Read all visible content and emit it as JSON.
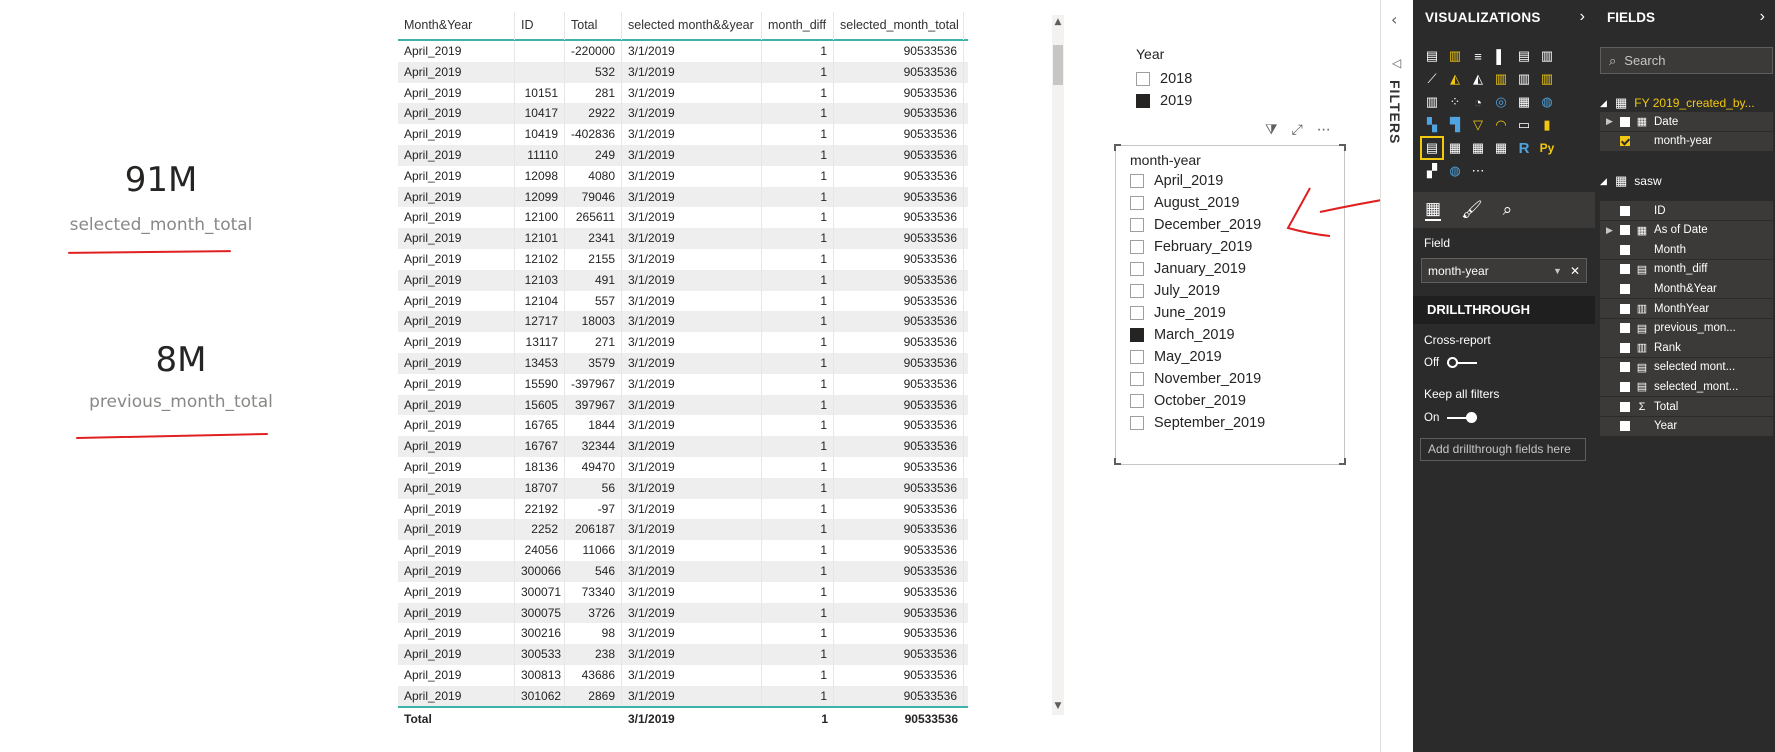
{
  "cards": [
    {
      "value": "91M",
      "label": "selected_month_total"
    },
    {
      "value": "8M",
      "label": "previous_month_total"
    }
  ],
  "table": {
    "columns": [
      "Month&Year",
      "ID",
      "Total",
      "selected month&&year",
      "month_diff",
      "selected_month_total"
    ],
    "rows": [
      [
        "April_2019",
        "",
        "-220000",
        "3/1/2019",
        "1",
        "90533536"
      ],
      [
        "April_2019",
        "",
        "532",
        "3/1/2019",
        "1",
        "90533536"
      ],
      [
        "April_2019",
        "10151",
        "281",
        "3/1/2019",
        "1",
        "90533536"
      ],
      [
        "April_2019",
        "10417",
        "2922",
        "3/1/2019",
        "1",
        "90533536"
      ],
      [
        "April_2019",
        "10419",
        "-402836",
        "3/1/2019",
        "1",
        "90533536"
      ],
      [
        "April_2019",
        "11110",
        "249",
        "3/1/2019",
        "1",
        "90533536"
      ],
      [
        "April_2019",
        "12098",
        "4080",
        "3/1/2019",
        "1",
        "90533536"
      ],
      [
        "April_2019",
        "12099",
        "79046",
        "3/1/2019",
        "1",
        "90533536"
      ],
      [
        "April_2019",
        "12100",
        "265611",
        "3/1/2019",
        "1",
        "90533536"
      ],
      [
        "April_2019",
        "12101",
        "2341",
        "3/1/2019",
        "1",
        "90533536"
      ],
      [
        "April_2019",
        "12102",
        "2155",
        "3/1/2019",
        "1",
        "90533536"
      ],
      [
        "April_2019",
        "12103",
        "491",
        "3/1/2019",
        "1",
        "90533536"
      ],
      [
        "April_2019",
        "12104",
        "557",
        "3/1/2019",
        "1",
        "90533536"
      ],
      [
        "April_2019",
        "12717",
        "18003",
        "3/1/2019",
        "1",
        "90533536"
      ],
      [
        "April_2019",
        "13117",
        "271",
        "3/1/2019",
        "1",
        "90533536"
      ],
      [
        "April_2019",
        "13453",
        "3579",
        "3/1/2019",
        "1",
        "90533536"
      ],
      [
        "April_2019",
        "15590",
        "-397967",
        "3/1/2019",
        "1",
        "90533536"
      ],
      [
        "April_2019",
        "15605",
        "397967",
        "3/1/2019",
        "1",
        "90533536"
      ],
      [
        "April_2019",
        "16765",
        "1844",
        "3/1/2019",
        "1",
        "90533536"
      ],
      [
        "April_2019",
        "16767",
        "32344",
        "3/1/2019",
        "1",
        "90533536"
      ],
      [
        "April_2019",
        "18136",
        "49470",
        "3/1/2019",
        "1",
        "90533536"
      ],
      [
        "April_2019",
        "18707",
        "56",
        "3/1/2019",
        "1",
        "90533536"
      ],
      [
        "April_2019",
        "22192",
        "-97",
        "3/1/2019",
        "1",
        "90533536"
      ],
      [
        "April_2019",
        "2252",
        "206187",
        "3/1/2019",
        "1",
        "90533536"
      ],
      [
        "April_2019",
        "24056",
        "11066",
        "3/1/2019",
        "1",
        "90533536"
      ],
      [
        "April_2019",
        "300066",
        "546",
        "3/1/2019",
        "1",
        "90533536"
      ],
      [
        "April_2019",
        "300071",
        "73340",
        "3/1/2019",
        "1",
        "90533536"
      ],
      [
        "April_2019",
        "300075",
        "3726",
        "3/1/2019",
        "1",
        "90533536"
      ],
      [
        "April_2019",
        "300216",
        "98",
        "3/1/2019",
        "1",
        "90533536"
      ],
      [
        "April_2019",
        "300533",
        "238",
        "3/1/2019",
        "1",
        "90533536"
      ],
      [
        "April_2019",
        "300813",
        "43686",
        "3/1/2019",
        "1",
        "90533536"
      ],
      [
        "April_2019",
        "301062",
        "2869",
        "3/1/2019",
        "1",
        "90533536"
      ]
    ],
    "total_row": [
      "Total",
      "",
      "",
      "3/1/2019",
      "1",
      "90533536"
    ]
  },
  "year_slicer": {
    "title": "Year",
    "items": [
      {
        "label": "2018",
        "checked": false
      },
      {
        "label": "2019",
        "checked": true
      }
    ]
  },
  "month_slicer": {
    "title": "month-year",
    "items": [
      {
        "label": "April_2019",
        "checked": false
      },
      {
        "label": "August_2019",
        "checked": false
      },
      {
        "label": "December_2019",
        "checked": false
      },
      {
        "label": "February_2019",
        "checked": false
      },
      {
        "label": "January_2019",
        "checked": false
      },
      {
        "label": "July_2019",
        "checked": false
      },
      {
        "label": "June_2019",
        "checked": false
      },
      {
        "label": "March_2019",
        "checked": true
      },
      {
        "label": "May_2019",
        "checked": false
      },
      {
        "label": "November_2019",
        "checked": false
      },
      {
        "label": "October_2019",
        "checked": false
      },
      {
        "label": "September_2019",
        "checked": false
      }
    ]
  },
  "filters_label": "FILTERS",
  "visualizations": {
    "title": "VISUALIZATIONS",
    "field_label": "Field",
    "field_value": "month-year",
    "drillthrough_title": "DRILLTHROUGH",
    "cross_report_label": "Cross-report",
    "cross_report_state": "Off",
    "keep_filters_label": "Keep all filters",
    "keep_filters_state": "On",
    "add_drill_placeholder": "Add drillthrough fields here",
    "r_label": "R",
    "py_label": "Py"
  },
  "fields": {
    "title": "FIELDS",
    "search_placeholder": "Search",
    "table1": "FY 2019_created_by...",
    "table1_fields": [
      {
        "name": "Date",
        "expandable": true,
        "checked": false,
        "type": "table"
      },
      {
        "name": "month-year",
        "expandable": false,
        "checked": true,
        "type": ""
      }
    ],
    "table2": "sasw",
    "table2_fields": [
      {
        "name": "ID",
        "expandable": false,
        "checked": false,
        "type": ""
      },
      {
        "name": "As of Date",
        "expandable": true,
        "checked": false,
        "type": "table"
      },
      {
        "name": "Month",
        "expandable": false,
        "checked": false,
        "type": ""
      },
      {
        "name": "month_diff",
        "expandable": false,
        "checked": false,
        "type": "calc"
      },
      {
        "name": "Month&Year",
        "expandable": false,
        "checked": false,
        "type": ""
      },
      {
        "name": "MonthYear",
        "expandable": false,
        "checked": false,
        "type": "column"
      },
      {
        "name": "previous_mon...",
        "expandable": false,
        "checked": false,
        "type": "calc"
      },
      {
        "name": "Rank",
        "expandable": false,
        "checked": false,
        "type": "column"
      },
      {
        "name": "selected mont...",
        "expandable": false,
        "checked": false,
        "type": "calc"
      },
      {
        "name": "selected_mont...",
        "expandable": false,
        "checked": false,
        "type": "calc"
      },
      {
        "name": "Total",
        "expandable": false,
        "checked": false,
        "type": "sigma"
      },
      {
        "name": "Year",
        "expandable": false,
        "checked": false,
        "type": ""
      }
    ]
  },
  "colors": {
    "accent_teal": "#3bb3a8",
    "brand_yellow": "#f2c811",
    "pane_dark": "#2b2b2b",
    "annotation_red": "#e02020"
  }
}
